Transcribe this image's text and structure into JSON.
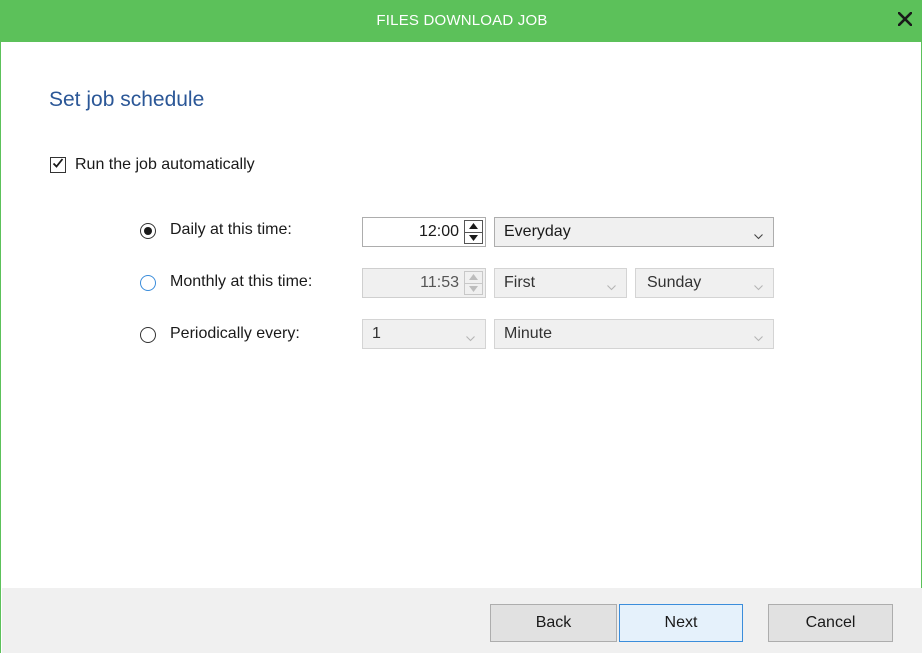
{
  "window": {
    "title": "FILES DOWNLOAD JOB"
  },
  "page": {
    "heading": "Set job schedule"
  },
  "auto_run": {
    "label": "Run the job automatically",
    "checked": true
  },
  "schedule": {
    "daily": {
      "label": "Daily at this time:",
      "selected": true,
      "time": "12:00",
      "frequency": "Everyday"
    },
    "monthly": {
      "label": "Monthly at this time:",
      "selected": false,
      "time": "11:53",
      "week": "First",
      "day": "Sunday"
    },
    "periodic": {
      "label": "Periodically every:",
      "selected": false,
      "count": "1",
      "unit": "Minute"
    }
  },
  "buttons": {
    "back": "Back",
    "next": "Next",
    "cancel": "Cancel"
  },
  "colors": {
    "titlebar": "#5cc15a",
    "heading": "#2b5797",
    "focus": "#3b8ddb"
  },
  "icons": {
    "close": "close-icon",
    "check": "checkmark-icon",
    "caret": "chevron-down-icon",
    "spin_up": "arrow-up-icon",
    "spin_down": "arrow-down-icon"
  }
}
